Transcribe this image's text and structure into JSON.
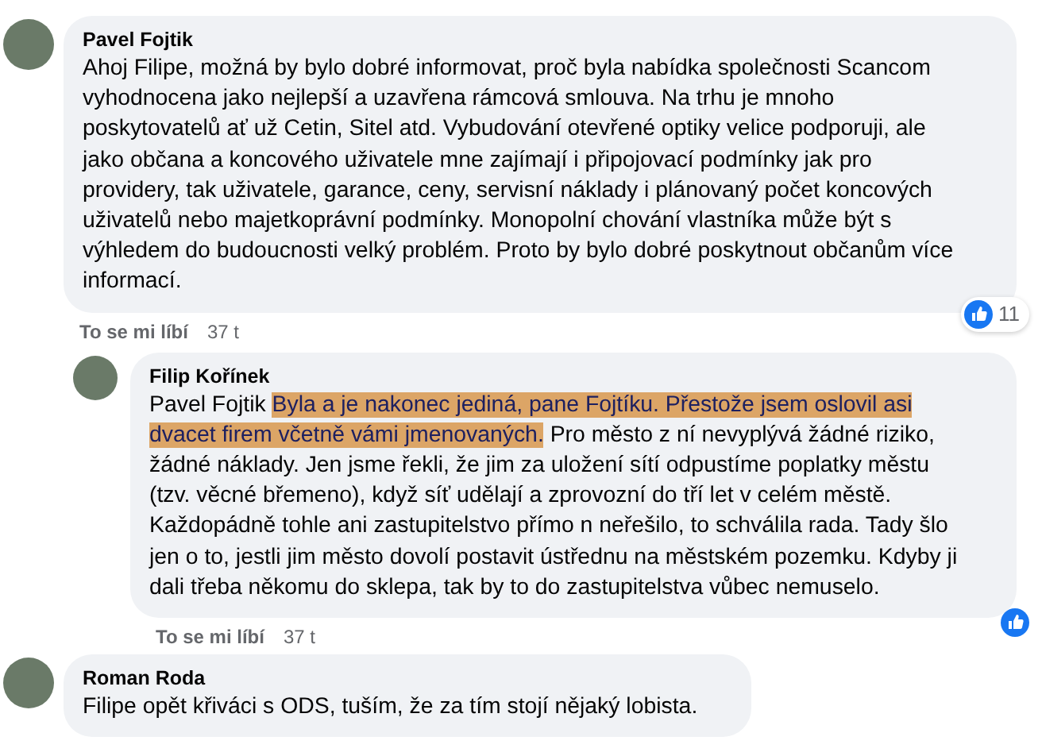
{
  "comments": [
    {
      "author": "Pavel Fojtik",
      "segments": [
        {
          "text": "Ahoj Filipe, možná by bylo dobré informovat, proč byla nabídka společnosti Scancom vyhodnocena jako nejlepší a uzavřena rámcová smlouva. Na trhu je mnoho poskytovatelů ať už Cetin, Sitel atd. Vybudování otevřené optiky velice podporuji, ale jako občana a koncového uživatele mne zajímají i připojovací podmínky jak pro providery, tak uživatele, garance, ceny, servisní náklady i plánovaný počet koncových uživatelů nebo majetkoprávní podmínky. Monopolní chování vlastníka může být s výhledem do budoucnosti velký problém. Proto by bylo dobré poskytnout občanům více informací.",
          "highlighted": false
        }
      ],
      "reactions": "11",
      "like_label": "To se mi líbí",
      "time": "37 t",
      "reply": false
    },
    {
      "author": "Filip Kořínek",
      "mention": "Pavel Fojtik",
      "segments": [
        {
          "text": "Byla a je nakonec jediná, pane Fojtíku. Přestože jsem oslovil asi dvacet firem včetně vámi jmenovaných.",
          "highlighted": true
        },
        {
          "text": " Pro město z ní nevyplývá žádné riziko, žádné náklady. Jen jsme řekli, že jim za uložení sítí odpustíme poplatky městu (tzv. věcné břemeno), když síť udělají a zprovozní do tří let v celém městě. Každopádně tohle ani zastupitelstvo přímo n neřešilo, to schválila rada. Tady šlo jen o to, jestli jim město dovolí postavit ústřednu na městském pozemku. Kdyby ji dali třeba někomu do sklepa, tak by to do zastupitelstva vůbec nemuselo.",
          "highlighted": false
        }
      ],
      "reacted": true,
      "like_label": "To se mi líbí",
      "time": "37 t",
      "reply": true
    },
    {
      "author": "Roman Roda",
      "segments": [
        {
          "text": "Filipe opět křiváci s ODS, tuším, že za tím stojí nějaký lobista.",
          "highlighted": false
        }
      ],
      "reply": false
    }
  ]
}
